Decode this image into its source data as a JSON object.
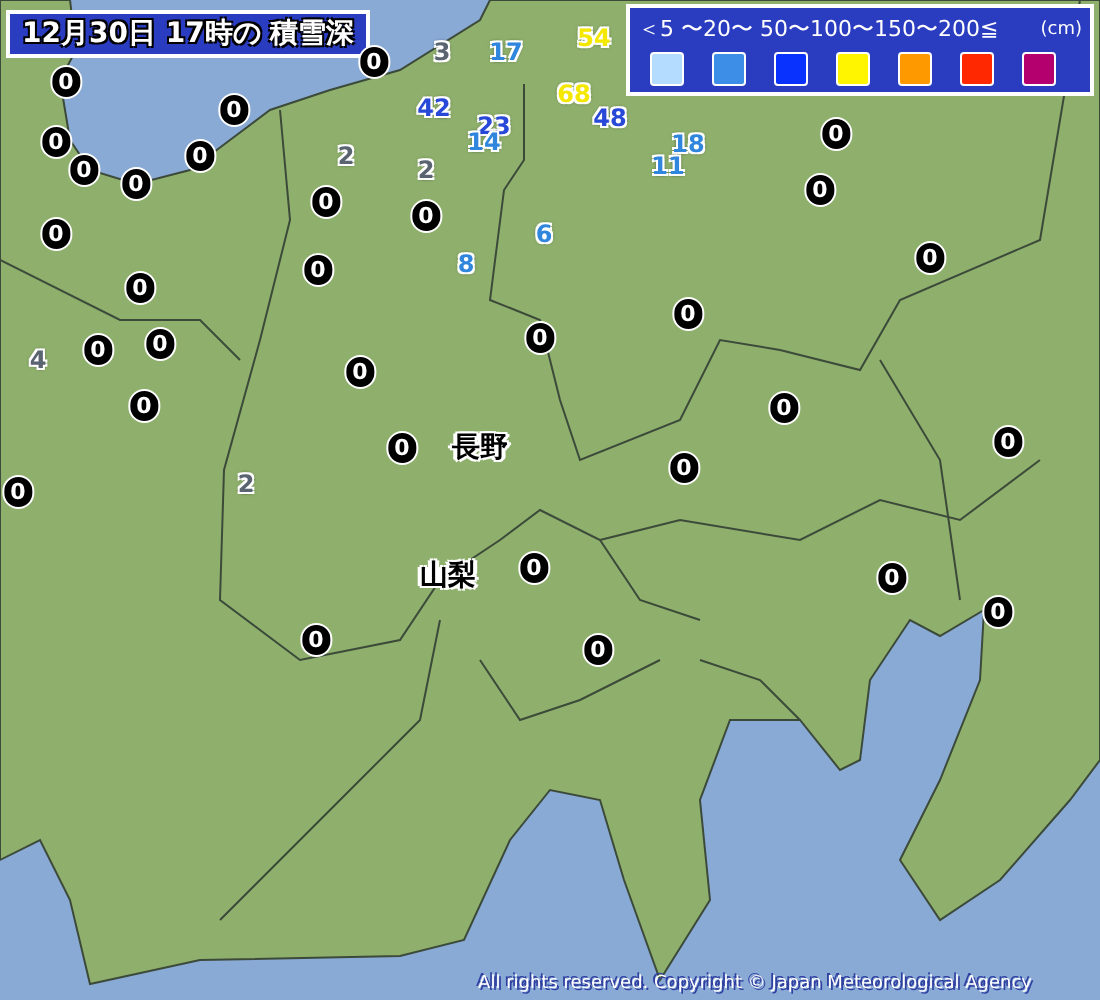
{
  "title": "12月30日 17時の 積雪深",
  "legend": {
    "scale": "＜5 〜20〜 50〜100〜150〜200≦",
    "unit": "(cm)",
    "swatches": [
      {
        "color": "#b4dcff"
      },
      {
        "color": "#3c8ee6"
      },
      {
        "color": "#0a32ff"
      },
      {
        "color": "#fff500"
      },
      {
        "color": "#ff9900"
      },
      {
        "color": "#ff2800"
      },
      {
        "color": "#b4006e"
      }
    ]
  },
  "prefectures": [
    {
      "name": "長野"
    },
    {
      "name": "山梨"
    }
  ],
  "stations": [
    {
      "value": "3",
      "kind": "plain",
      "color": "#5a6470"
    },
    {
      "value": "17",
      "kind": "plain",
      "color": "#2f86dc"
    },
    {
      "value": "54",
      "kind": "plain",
      "color": "#f5e800"
    },
    {
      "value": "0",
      "kind": "pill",
      "color": "#ffffff"
    },
    {
      "value": "0",
      "kind": "pill",
      "color": "#ffffff"
    },
    {
      "value": "42",
      "kind": "plain",
      "color": "#2848d8"
    },
    {
      "value": "68",
      "kind": "plain",
      "color": "#f5e800"
    },
    {
      "value": "23",
      "kind": "plain",
      "color": "#2848d8"
    },
    {
      "value": "48",
      "kind": "plain",
      "color": "#2848d8"
    },
    {
      "value": "0",
      "kind": "pill",
      "color": "#ffffff"
    },
    {
      "value": "0",
      "kind": "pill",
      "color": "#ffffff"
    },
    {
      "value": "0",
      "kind": "pill",
      "color": "#ffffff"
    },
    {
      "value": "0",
      "kind": "pill",
      "color": "#ffffff"
    },
    {
      "value": "0",
      "kind": "pill",
      "color": "#ffffff"
    },
    {
      "value": "2",
      "kind": "plain",
      "color": "#5a6470"
    },
    {
      "value": "2",
      "kind": "plain",
      "color": "#5a6470"
    },
    {
      "value": "14",
      "kind": "plain",
      "color": "#2f86dc"
    },
    {
      "value": "18",
      "kind": "plain",
      "color": "#2f86dc"
    },
    {
      "value": "11",
      "kind": "plain",
      "color": "#2f86dc"
    },
    {
      "value": "0",
      "kind": "pill",
      "color": "#ffffff"
    },
    {
      "value": "0",
      "kind": "pill",
      "color": "#ffffff"
    },
    {
      "value": "0",
      "kind": "pill",
      "color": "#ffffff"
    },
    {
      "value": "0",
      "kind": "pill",
      "color": "#ffffff"
    },
    {
      "value": "6",
      "kind": "plain",
      "color": "#2f86dc"
    },
    {
      "value": "8",
      "kind": "plain",
      "color": "#2f86dc"
    },
    {
      "value": "0",
      "kind": "pill",
      "color": "#ffffff"
    },
    {
      "value": "0",
      "kind": "pill",
      "color": "#ffffff"
    },
    {
      "value": "0",
      "kind": "pill",
      "color": "#ffffff"
    },
    {
      "value": "0",
      "kind": "pill",
      "color": "#ffffff"
    },
    {
      "value": "4",
      "kind": "plain",
      "color": "#5a6470"
    },
    {
      "value": "0",
      "kind": "pill",
      "color": "#ffffff"
    },
    {
      "value": "0",
      "kind": "pill",
      "color": "#ffffff"
    },
    {
      "value": "0",
      "kind": "pill",
      "color": "#ffffff"
    },
    {
      "value": "0",
      "kind": "pill",
      "color": "#ffffff"
    },
    {
      "value": "0",
      "kind": "pill",
      "color": "#ffffff"
    },
    {
      "value": "0",
      "kind": "pill",
      "color": "#ffffff"
    },
    {
      "value": "0",
      "kind": "pill",
      "color": "#ffffff"
    },
    {
      "value": "0",
      "kind": "pill",
      "color": "#ffffff"
    },
    {
      "value": "0",
      "kind": "pill",
      "color": "#ffffff"
    },
    {
      "value": "2",
      "kind": "plain",
      "color": "#5a6470"
    },
    {
      "value": "0",
      "kind": "pill",
      "color": "#ffffff"
    },
    {
      "value": "0",
      "kind": "pill",
      "color": "#ffffff"
    },
    {
      "value": "0",
      "kind": "pill",
      "color": "#ffffff"
    },
    {
      "value": "0",
      "kind": "pill",
      "color": "#ffffff"
    },
    {
      "value": "0",
      "kind": "pill",
      "color": "#ffffff"
    },
    {
      "value": "0",
      "kind": "pill",
      "color": "#ffffff"
    },
    {
      "value": "0",
      "kind": "pill",
      "color": "#ffffff"
    }
  ],
  "copyright": "All rights reserved. Copyright © Japan Meteorological Agency"
}
